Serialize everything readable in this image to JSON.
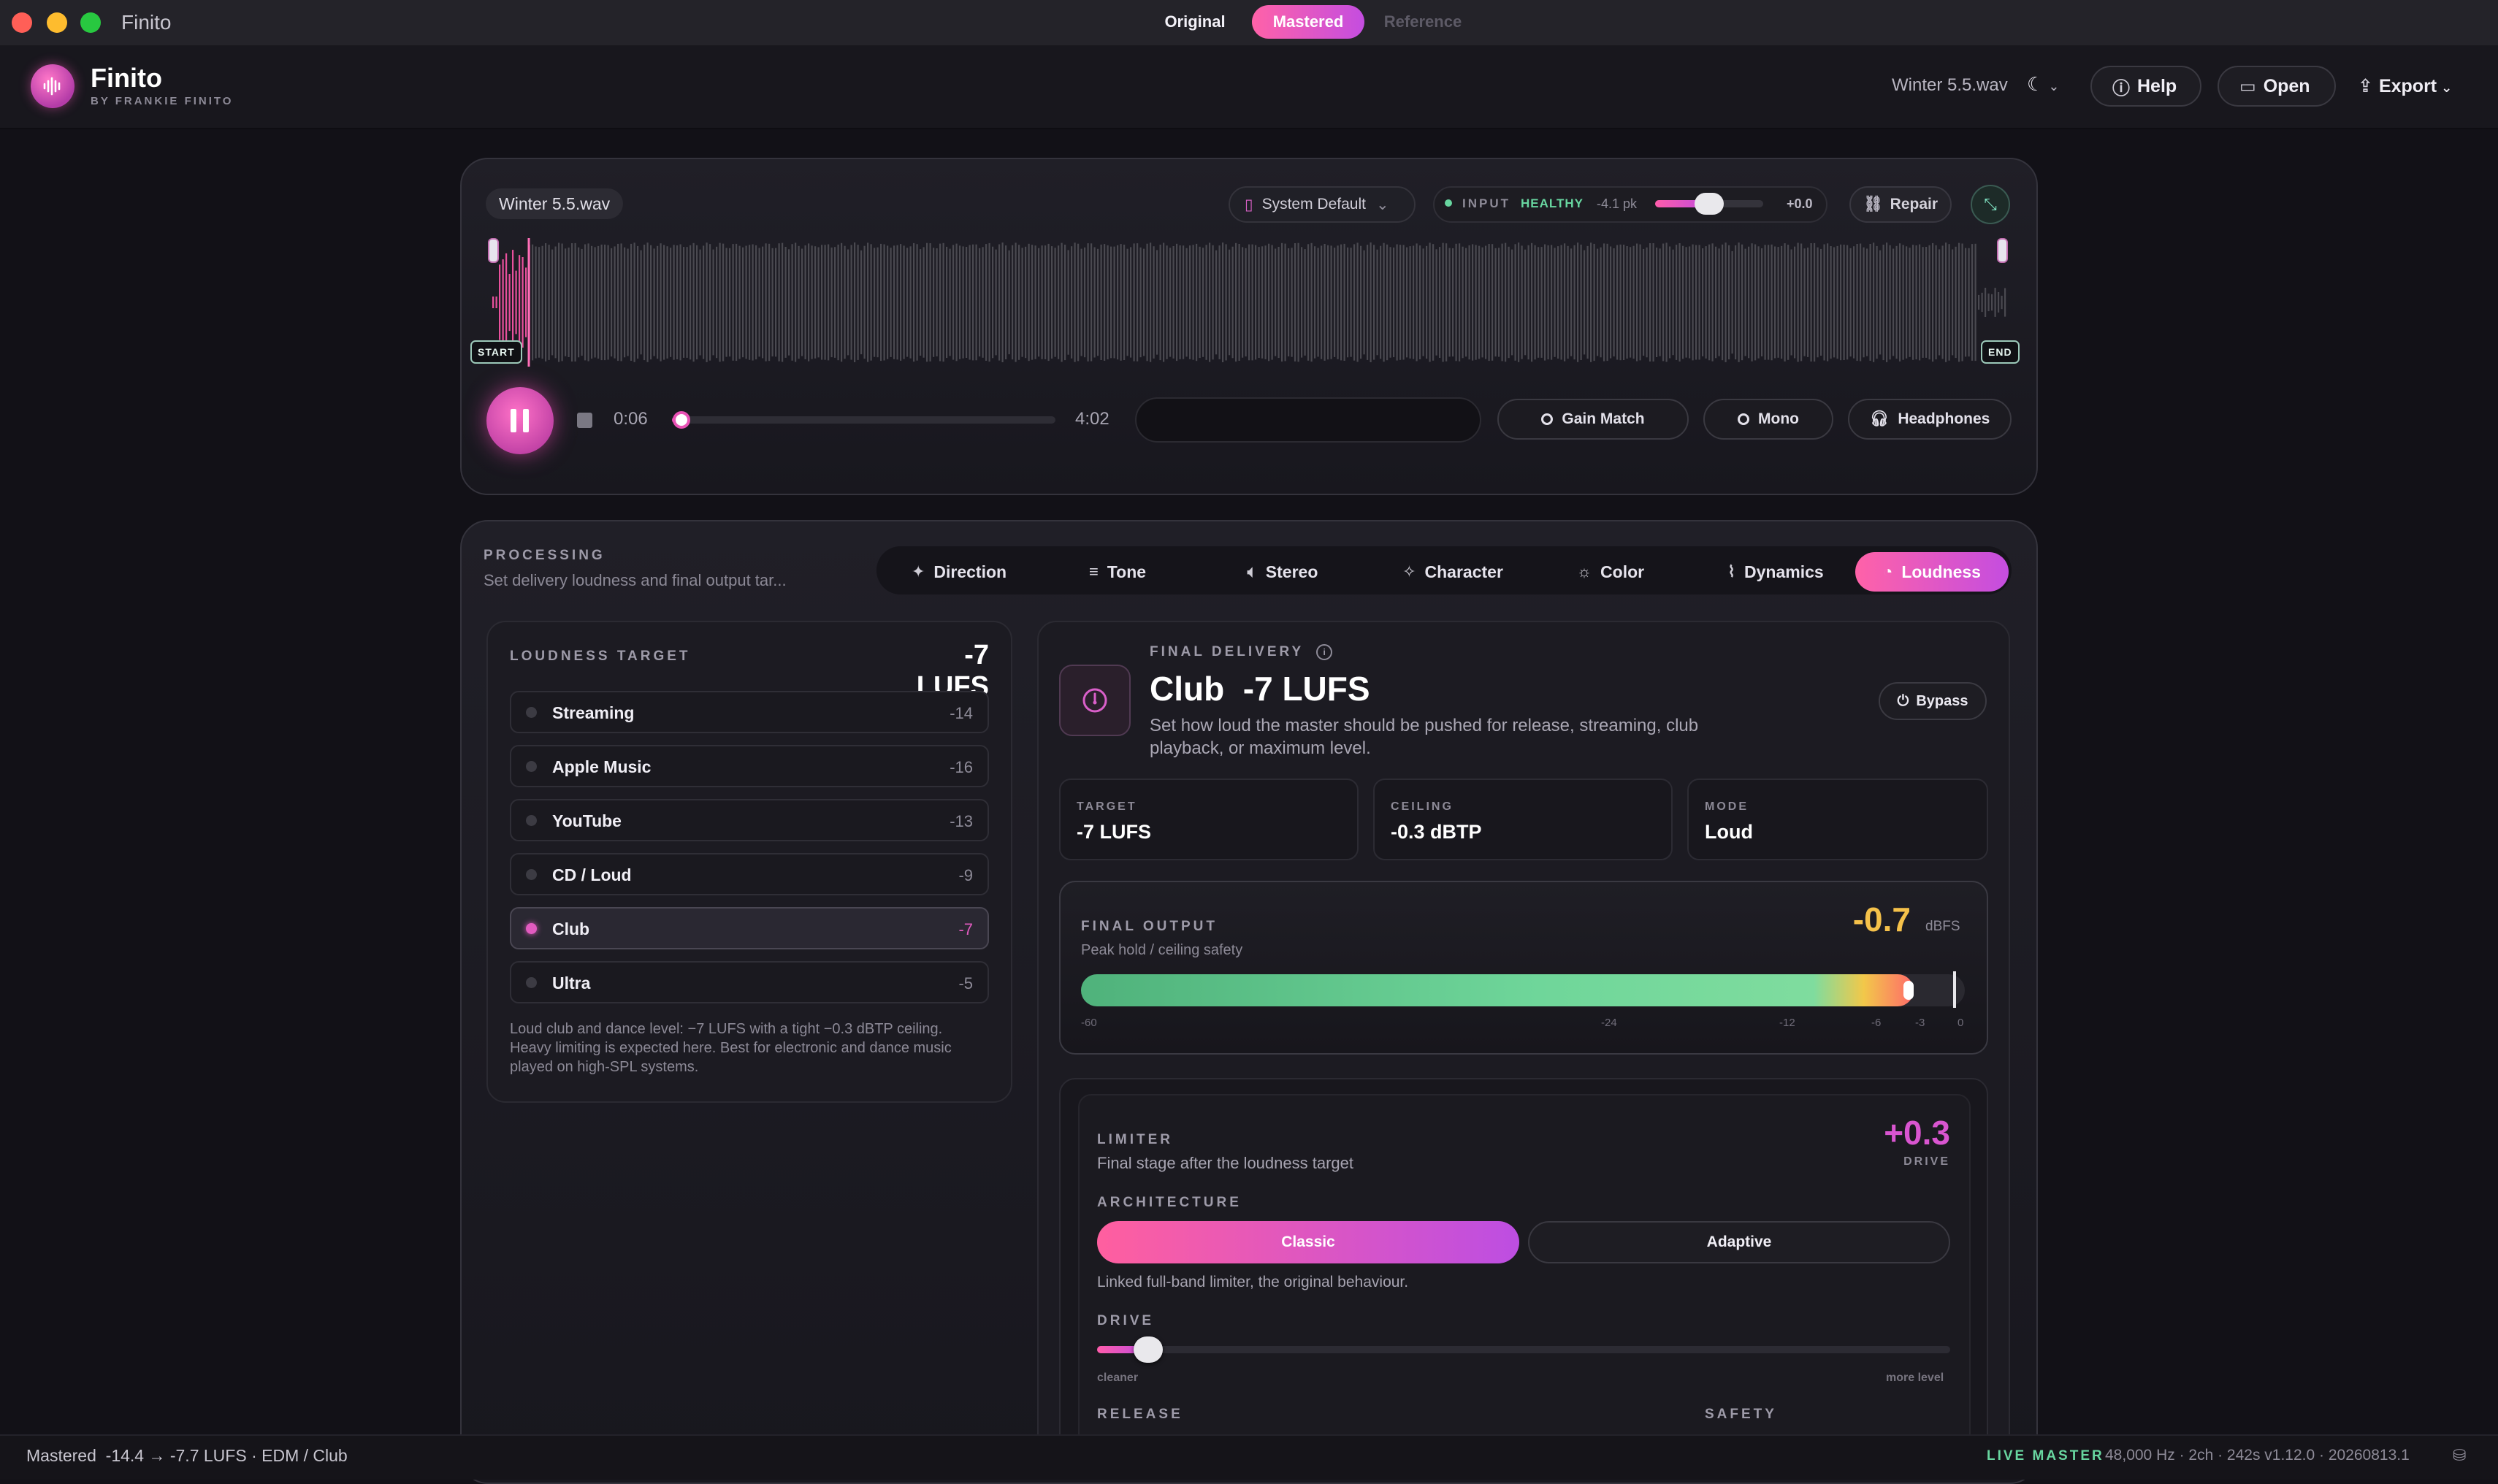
{
  "window": {
    "title": "Finito"
  },
  "brand": {
    "name": "Finito",
    "byline": "BY FRANKIE FINITO"
  },
  "header": {
    "file": "Winter 5.5.wav",
    "theme_icon": "moon-icon",
    "help": "Help",
    "open": "Open",
    "export": "Export"
  },
  "player": {
    "file": "Winter 5.5.wav",
    "device": "System Default",
    "input_label": "INPUT",
    "input_status": "HEALTHY",
    "input_peak": "-4.1 pk",
    "input_gain": "+0.0",
    "input_gain_level": 0.5,
    "repair": "Repair",
    "start_label": "START",
    "end_label": "END",
    "current_time": "0:06",
    "total_time": "4:02",
    "progress": 0.025,
    "ab": {
      "original": "Original",
      "mastered": "Mastered",
      "reference": "Reference",
      "selected": "Mastered"
    },
    "gain_match": "Gain Match",
    "mono": "Mono",
    "headphones": "Headphones"
  },
  "processing": {
    "title": "PROCESSING",
    "subtitle": "Set delivery loudness and final output tar...",
    "tabs": [
      {
        "label": "Direction",
        "icon": "sparkle-icon"
      },
      {
        "label": "Tone",
        "icon": "sliders-icon"
      },
      {
        "label": "Stereo",
        "icon": "speaker-icon"
      },
      {
        "label": "Character",
        "icon": "sparkle-icon"
      },
      {
        "label": "Color",
        "icon": "sun-icon"
      },
      {
        "label": "Dynamics",
        "icon": "pulse-icon"
      },
      {
        "label": "Loudness",
        "icon": "gauge-icon"
      }
    ],
    "active_tab": "Loudness"
  },
  "loudness_target": {
    "title": "LOUDNESS TARGET",
    "value": "-7 LUFS",
    "options": [
      {
        "name": "Streaming",
        "value": "-14"
      },
      {
        "name": "Apple Music",
        "value": "-16"
      },
      {
        "name": "YouTube",
        "value": "-13"
      },
      {
        "name": "CD / Loud",
        "value": "-9"
      },
      {
        "name": "Club",
        "value": "-7"
      },
      {
        "name": "Ultra",
        "value": "-5"
      }
    ],
    "selected": "Club",
    "description": "Loud club and dance level: −7 LUFS with a tight −0.3 dBTP ceiling. Heavy limiting is expected here. Best for electronic and dance music played on high-SPL systems."
  },
  "final_delivery": {
    "label": "FINAL DELIVERY",
    "title": "Club  -7 LUFS",
    "description": "Set how loud the master should be pushed for release, streaming, club playback, or maximum level.",
    "bypass": "Bypass",
    "stats": [
      {
        "key": "TARGET",
        "value": "-7 LUFS"
      },
      {
        "key": "CEILING",
        "value": "-0.3 dBTP"
      },
      {
        "key": "MODE",
        "value": "Loud"
      }
    ]
  },
  "final_output": {
    "label": "FINAL OUTPUT",
    "subtitle": "Peak hold / ceiling safety",
    "value": "-0.7",
    "unit": "dBFS",
    "level_dbfs": -0.7,
    "ticks": [
      "-60",
      "-24",
      "-12",
      "-6",
      "-3",
      "0"
    ]
  },
  "limiter": {
    "label": "LIMITER",
    "subtitle": "Final stage after the loudness target",
    "value": "+0.3",
    "value_label": "DRIVE",
    "architecture_label": "ARCHITECTURE",
    "architectures": [
      "Classic",
      "Adaptive"
    ],
    "architecture_selected": "Classic",
    "architecture_desc": "Linked full-band limiter, the original behaviour.",
    "drive_label": "DRIVE",
    "drive_level": 0.06,
    "drive_min": "cleaner",
    "drive_max": "more level",
    "release_label": "RELEASE",
    "safety_label": "SAFETY"
  },
  "status": {
    "left": "Mastered  -14.4 → -7.7 LUFS · EDM / Club",
    "live": "LIVE MASTER",
    "info": "48,000 Hz · 2ch · 242s  v1.12.0 · 20260813.1"
  },
  "colors": {
    "accent_pink": "#ff62a8",
    "accent_purple": "#c44de0",
    "healthy": "#68d6a0",
    "output_value": "#f5c14a"
  }
}
